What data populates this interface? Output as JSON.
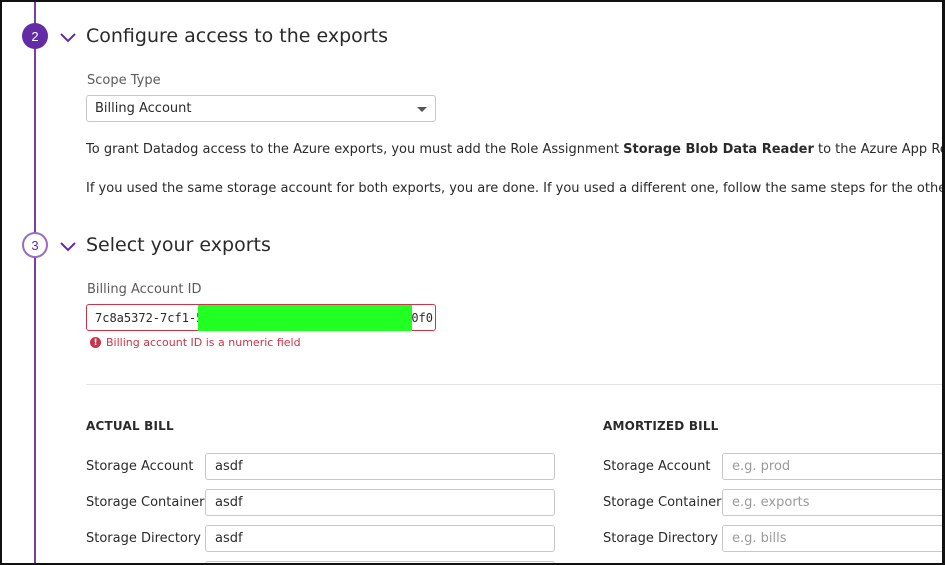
{
  "steps": {
    "configure": {
      "number": "2",
      "title": "Configure access to the exports"
    },
    "select": {
      "number": "3",
      "title": "Select your exports"
    }
  },
  "scope": {
    "label": "Scope Type",
    "selected": "Billing Account"
  },
  "instructions": {
    "line1_pre": "To grant Datadog access to the Azure exports, you must add the Role Assignment ",
    "line1_bold": "Storage Blob Data Reader",
    "line1_post": " to the Azure App Registration. S",
    "line2": "If you used the same storage account for both exports, you are done. If you used a different one, follow the same steps for the other storage"
  },
  "billing": {
    "label": "Billing Account ID",
    "value_start": "7c8a5372-7cf1-58",
    "value_end": "0f0",
    "error": "Billing account ID is a numeric field"
  },
  "actual_bill": {
    "heading": "ACTUAL BILL",
    "storage_account_label": "Storage Account",
    "storage_account_value": "asdf",
    "storage_container_label": "Storage Container",
    "storage_container_value": "asdf",
    "storage_directory_label": "Storage Directory",
    "storage_directory_value": "asdf"
  },
  "amortized_bill": {
    "heading": "AMORTIZED BILL",
    "storage_account_label": "Storage Account",
    "storage_account_placeholder": "e.g. prod",
    "storage_container_label": "Storage Container",
    "storage_container_placeholder": "e.g. exports",
    "storage_directory_label": "Storage Directory",
    "storage_directory_placeholder": "e.g. bills"
  },
  "colors": {
    "brand_purple": "#632ca6",
    "error_red": "#c8344a",
    "redaction_green": "#22ff22"
  },
  "icons": {
    "collapse": "chevron-down-icon",
    "dropdown": "caret-down-icon",
    "error": "exclamation-circle-icon"
  }
}
